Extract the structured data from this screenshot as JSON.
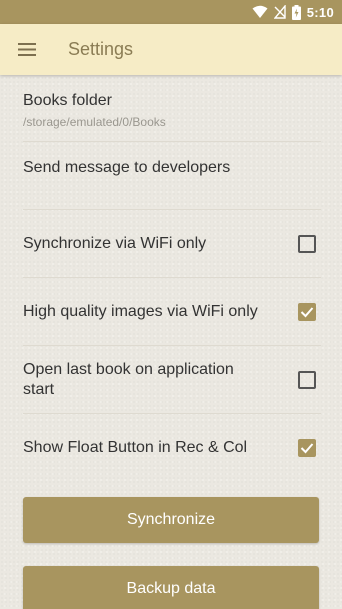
{
  "status_bar": {
    "time": "5:10",
    "icons": [
      "wifi-icon",
      "signal-off-icon",
      "battery-charging-icon"
    ]
  },
  "app_bar": {
    "menu_icon": "hamburger-menu-icon",
    "title": "Settings"
  },
  "settings": {
    "books_folder": {
      "title": "Books folder",
      "subtitle": "/storage/emulated/0/Books"
    },
    "send_message": {
      "title": "Send message to developers"
    },
    "prefs": [
      {
        "label": "Synchronize via WiFi only",
        "checked": false
      },
      {
        "label": "High quality images via WiFi only",
        "checked": true
      },
      {
        "label": "Open last book on application start",
        "checked": false
      },
      {
        "label": "Show Float Button in Rec & Col",
        "checked": true
      }
    ]
  },
  "buttons": {
    "synchronize": "Synchronize",
    "backup": "Backup data"
  },
  "colors": {
    "accent": "#a8955f",
    "app_bar": "#f6ecc6",
    "background": "#ebe8e1"
  }
}
